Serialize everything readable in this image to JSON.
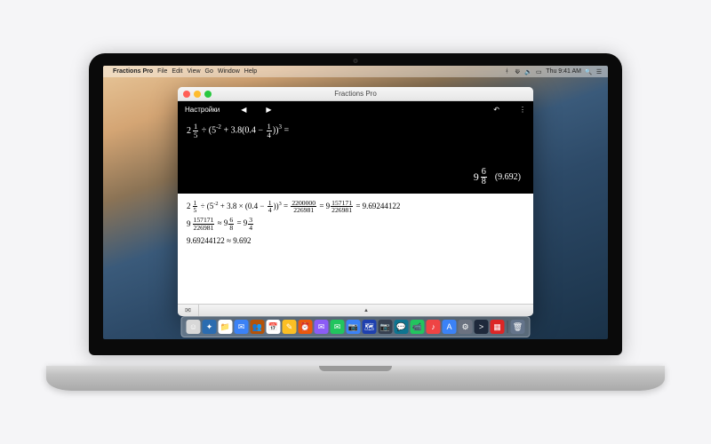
{
  "menubar": {
    "apple_icon": "",
    "appname": "Fractions Pro",
    "items": [
      "File",
      "Edit",
      "View",
      "Go",
      "Window",
      "Help"
    ],
    "right_time": "Thu 9:41 AM",
    "search_icon": "🔍",
    "hamburger_icon": "☰"
  },
  "window": {
    "title": "Fractions Pro",
    "toolbar": {
      "settings_label": "Настройки",
      "back_icon": "◀",
      "forward_icon": "▶",
      "undo_icon": "↶",
      "menu_icon": "⋮"
    },
    "expression": {
      "mixed_whole": "2",
      "mixed_num": "1",
      "mixed_den": "5",
      "op1": "÷",
      "lparen": "(5",
      "exp1": "-2",
      "plus": " + 3.8(0.4 − ",
      "frac2_num": "1",
      "frac2_den": "4",
      "rparen": "))",
      "exp2": "3",
      "equals": " ="
    },
    "result": {
      "mixed_whole": "9",
      "mixed_num": "6",
      "mixed_den": "8",
      "decimal": "(9.692)"
    },
    "work": {
      "line1_a_whole": "2",
      "line1_a_num": "1",
      "line1_a_den": "5",
      "line1_mid": " ÷ (5",
      "line1_exp1": "-2",
      "line1_mid2": " + 3.8 × (0.4 − ",
      "line1_f_num": "1",
      "line1_f_den": "4",
      "line1_mid3": "))",
      "line1_exp2": "3",
      "line1_eq": " = ",
      "line1_big_num": "2200000",
      "line1_big_den": "226981",
      "line1_eq2": " = 9",
      "line1_r_num": "157171",
      "line1_r_den": "226981",
      "line1_eq3": " = 9.69244122",
      "line2_a_whole": "9",
      "line2_a_num": "157171",
      "line2_a_den": "226981",
      "line2_approx": " ≈ 9",
      "line2_b_num": "6",
      "line2_b_den": "8",
      "line2_eq": " = 9",
      "line2_c_num": "3",
      "line2_c_den": "4",
      "line3": "9.69244122 ≈ 9.692"
    },
    "bottom": {
      "mail_icon": "✉",
      "collapse_icon": "▲"
    }
  },
  "dock_items": [
    {
      "c": "#d8d8d8",
      "t": "☺"
    },
    {
      "c": "#2b6cb0",
      "t": "✦"
    },
    {
      "c": "#ffffff",
      "t": "📁"
    },
    {
      "c": "#3b82f6",
      "t": "✉"
    },
    {
      "c": "#b45309",
      "t": "👥"
    },
    {
      "c": "#ffffff",
      "t": "📅"
    },
    {
      "c": "#fbbf24",
      "t": "✎"
    },
    {
      "c": "#ea580c",
      "t": "⏰"
    },
    {
      "c": "#8b5cf6",
      "t": "✉"
    },
    {
      "c": "#22c55e",
      "t": "✉"
    },
    {
      "c": "#3b82f6",
      "t": "📷"
    },
    {
      "c": "#1e40af",
      "t": "🗺"
    },
    {
      "c": "#374151",
      "t": "📷"
    },
    {
      "c": "#0e7490",
      "t": "💬"
    },
    {
      "c": "#22c55e",
      "t": "📹"
    },
    {
      "c": "#ef4444",
      "t": "♪"
    },
    {
      "c": "#3b82f6",
      "t": "A"
    },
    {
      "c": "#6b7280",
      "t": "⚙"
    },
    {
      "c": "#1e293b",
      "t": ">"
    },
    {
      "c": "#dc2626",
      "t": "▦"
    },
    {
      "c": "#64748b",
      "t": "🗑"
    }
  ]
}
